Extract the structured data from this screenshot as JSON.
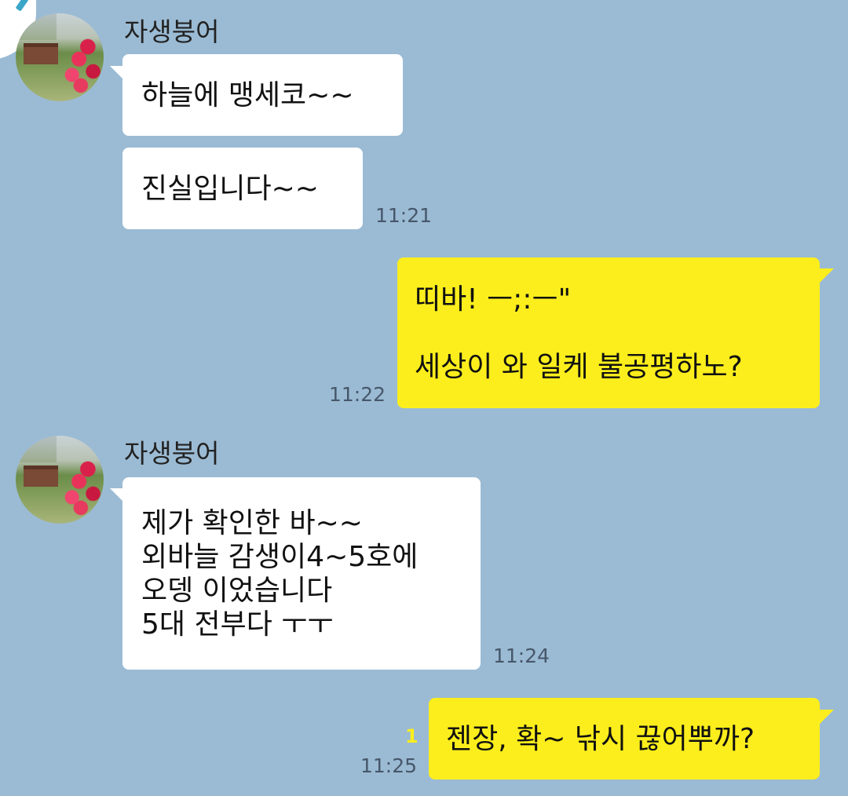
{
  "chat": {
    "messages": [
      {
        "sender": "자생붕어",
        "direction": "incoming",
        "text": "하늘에 맹세코~~"
      },
      {
        "sender": "자생붕어",
        "direction": "incoming",
        "text": "진실입니다~~",
        "time": "11:21"
      },
      {
        "sender": "me",
        "direction": "outgoing",
        "text": "띠바! ㅡ;:ㅡ\"\n\n세상이 와 일케 불공평하노?",
        "time": "11:22"
      },
      {
        "sender": "자생붕어",
        "direction": "incoming",
        "text": "제가 확인한 바~~\n외바늘 감생이4~5호에\n오뎅 이었습니다\n5대 전부다 ㅜㅜ",
        "time": "11:24"
      },
      {
        "sender": "me",
        "direction": "outgoing",
        "text": "젠장, 확~ 낚시 끊어뿌까?",
        "time": "11:25",
        "unread_count": "1"
      }
    ]
  },
  "contact": {
    "name": "자생붕어",
    "avatar_icon": "profile-photo-flowers"
  },
  "colors": {
    "background": "#9bbbd4",
    "incoming_bubble": "#ffffff",
    "outgoing_bubble": "#fcee1c",
    "unread": "#fcee1c"
  }
}
